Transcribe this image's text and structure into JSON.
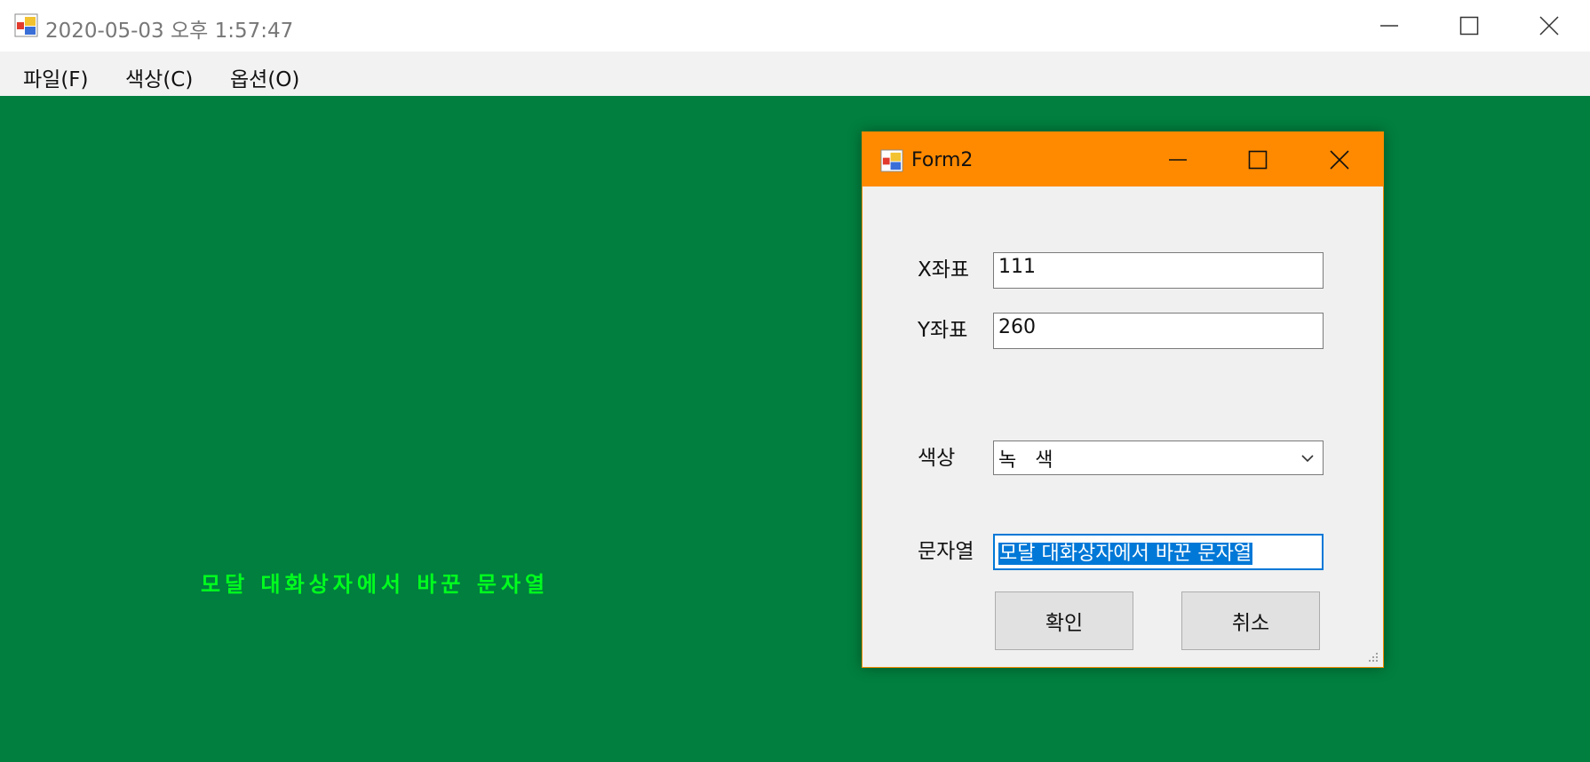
{
  "window": {
    "title": "2020-05-03 오후 1:57:47",
    "icon": "app-window-icon",
    "controls": [
      "minimize-icon",
      "maximize-icon",
      "close-icon"
    ]
  },
  "menubar": {
    "items": [
      {
        "label": "파일(F)"
      },
      {
        "label": "색상(C)"
      },
      {
        "label": "옵션(O)"
      }
    ]
  },
  "canvas": {
    "drawn_text": "모달 대화상자에서 바꾼 문자열",
    "background_color": "#007f3e",
    "text_color": "#00ff1e"
  },
  "dialog": {
    "title": "Form2",
    "title_color": "#ff8a00",
    "x_label": "X좌표",
    "x_value": "111",
    "y_label": "Y좌표",
    "y_value": "260",
    "color_label": "색상",
    "color_value": "녹   색",
    "string_label": "문자열",
    "string_value": "모달 대화상자에서 바꾼 문자열",
    "ok_label": "확인",
    "cancel_label": "취소"
  }
}
